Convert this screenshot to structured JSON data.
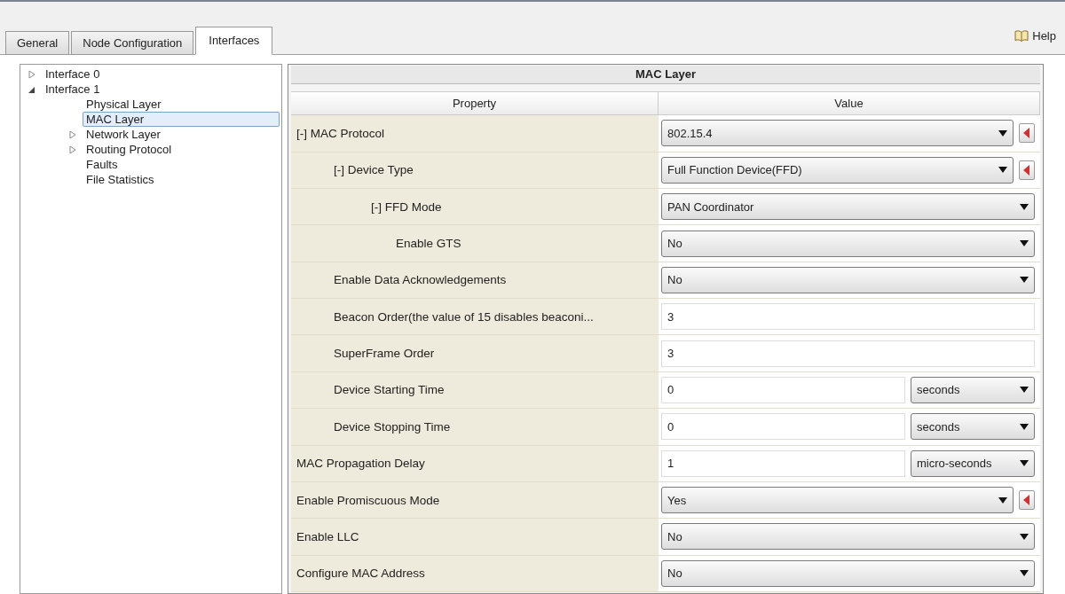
{
  "tabs": [
    {
      "label": "General",
      "selected": false
    },
    {
      "label": "Node Configuration",
      "selected": false
    },
    {
      "label": "Interfaces",
      "selected": true
    }
  ],
  "help": {
    "label": "Help"
  },
  "tree": [
    {
      "label": "Interface 0",
      "expanded": false,
      "selected": false
    },
    {
      "label": "Interface 1",
      "expanded": true,
      "selected": false,
      "children": [
        {
          "label": "Physical Layer",
          "selected": false
        },
        {
          "label": "MAC Layer",
          "selected": true
        },
        {
          "label": "Network Layer",
          "expanded": false,
          "selected": false
        },
        {
          "label": "Routing Protocol",
          "expanded": false,
          "selected": false
        },
        {
          "label": "Faults",
          "selected": false
        },
        {
          "label": "File Statistics",
          "selected": false
        }
      ]
    }
  ],
  "panel": {
    "title": "MAC Layer",
    "columns": [
      "Property",
      "Value"
    ],
    "rows": [
      {
        "label": "[-] MAC Protocol",
        "kind": "select",
        "value": "802.15.4",
        "reset": true,
        "children": [
          {
            "label": "[-] Device Type",
            "kind": "select",
            "value": "Full Function Device(FFD)",
            "reset": true,
            "children": [
              {
                "label": "[-] FFD Mode",
                "kind": "select",
                "value": "PAN Coordinator",
                "reset": false,
                "children": [
                  {
                    "label": "Enable GTS",
                    "kind": "select",
                    "value": "No",
                    "reset": false,
                    "deep": true
                  }
                ]
              }
            ]
          },
          {
            "label": "Enable Data Acknowledgements",
            "kind": "select",
            "value": "No",
            "reset": false
          },
          {
            "label": "Beacon Order(the value of 15 disables beaconi...",
            "kind": "text",
            "value": "3"
          },
          {
            "label": "SuperFrame Order",
            "kind": "text",
            "value": "3"
          },
          {
            "label": "Device Starting Time",
            "kind": "unit",
            "value": "0",
            "unit": "seconds"
          },
          {
            "label": "Device Stopping Time",
            "kind": "unit",
            "value": "0",
            "unit": "seconds"
          }
        ]
      },
      {
        "label": "MAC Propagation Delay",
        "kind": "unit",
        "value": "1",
        "unit": "micro-seconds"
      },
      {
        "label": "Enable Promiscuous Mode",
        "kind": "select",
        "value": "Yes",
        "reset": true
      },
      {
        "label": "Enable LLC",
        "kind": "select",
        "value": "No",
        "reset": false
      },
      {
        "label": "Configure MAC Address",
        "kind": "select",
        "value": "No",
        "reset": false
      }
    ]
  }
}
